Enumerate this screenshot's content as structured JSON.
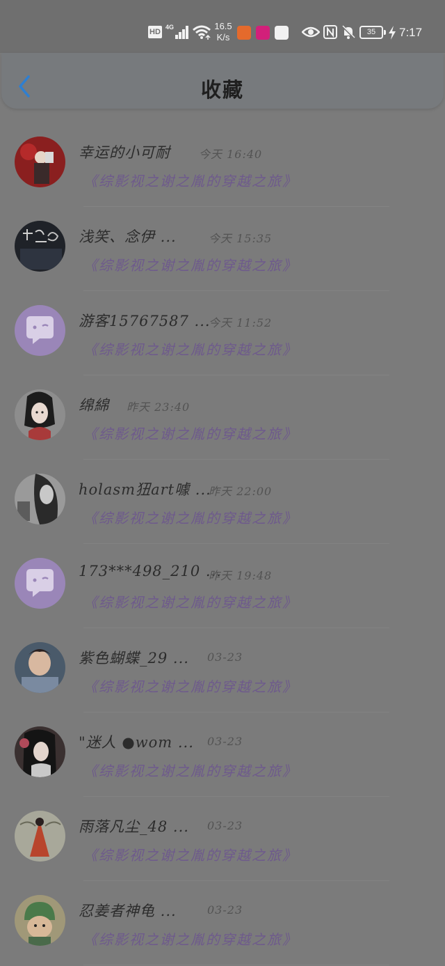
{
  "status_bar": {
    "hd": "HD",
    "network": "4G",
    "speed_value": "16.5",
    "speed_unit": "K/s",
    "battery": "35",
    "time": "7:17",
    "icons": [
      "hd-icon",
      "signal-icon",
      "wifi-icon",
      "app-icon",
      "app-icon",
      "huawei-icon",
      "eye-icon",
      "nfc-icon",
      "bell-off-icon",
      "battery-icon",
      "charging-icon"
    ]
  },
  "header": {
    "title": "收藏",
    "back_icon": "chevron-left-icon",
    "accent": "#2f7fd0"
  },
  "favorites": [
    {
      "name": "幸运的小可耐",
      "time": "今天 16:40",
      "book": "《综影视之谢之胤的穿越之旅》"
    },
    {
      "name": "浅笑、念伊 ...",
      "time": "今天 15:35",
      "book": "《综影视之谢之胤的穿越之旅》"
    },
    {
      "name": "游客15767587 ...",
      "time": "今天 11:52",
      "book": "《综影视之谢之胤的穿越之旅》"
    },
    {
      "name": "绵綿",
      "time": "昨天 23:40",
      "book": "《综影视之谢之胤的穿越之旅》"
    },
    {
      "name": "holasm狃art噱 ...",
      "time": "昨天 22:00",
      "book": "《综影视之谢之胤的穿越之旅》"
    },
    {
      "name": "173***498_210 ...",
      "time": "昨天 19:48",
      "book": "《综影视之谢之胤的穿越之旅》"
    },
    {
      "name": "紫色蝴蝶_29 ...",
      "time": "03-23",
      "book": "《综影视之谢之胤的穿越之旅》"
    },
    {
      "name": "\"迷人 ●wom ...",
      "time": "03-23",
      "book": "《综影视之谢之胤的穿越之旅》"
    },
    {
      "name": "雨落凡尘_48 ...",
      "time": "03-23",
      "book": "《综影视之谢之胤的穿越之旅》"
    },
    {
      "name": "忍姜者神龟 ...",
      "time": "03-23",
      "book": "《综影视之谢之胤的穿越之旅》"
    }
  ],
  "colors": {
    "book_title": "#6e5a8c",
    "default_avatar": "#9a86b8"
  }
}
